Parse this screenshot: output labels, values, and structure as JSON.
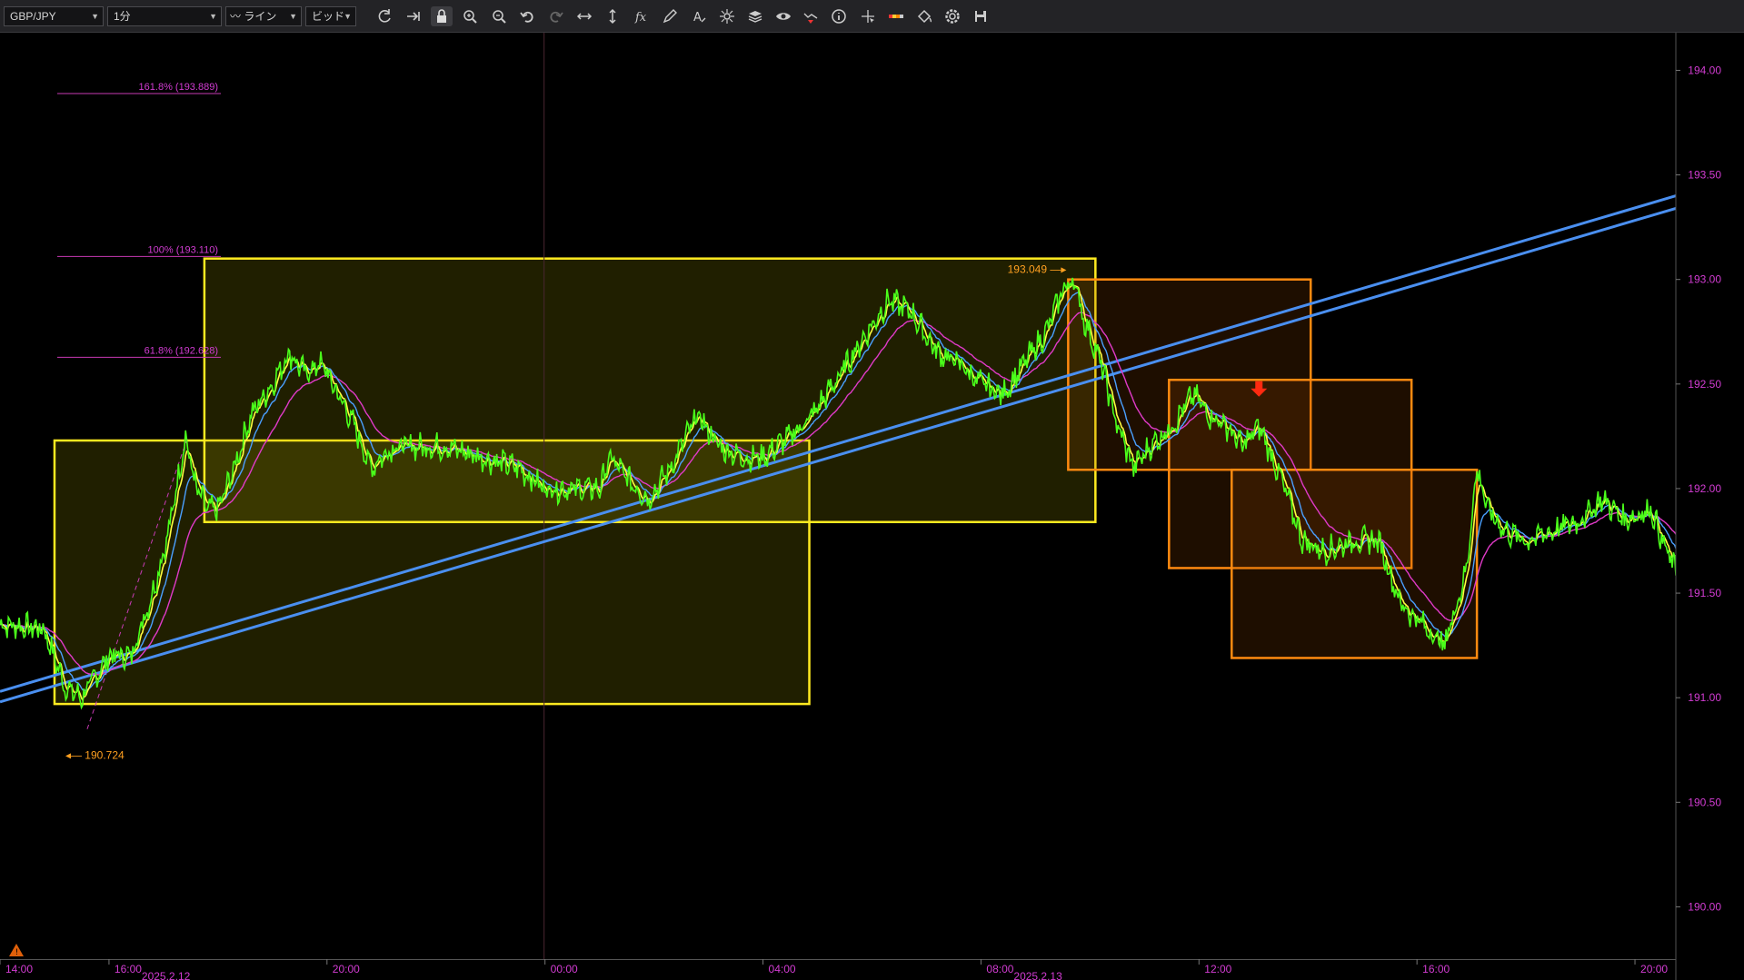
{
  "toolbar": {
    "symbol": "GBP/JPY",
    "timeframe": "1分",
    "chart_type": "ライン",
    "price_type": "ビッド",
    "icons": [
      "refresh-icon",
      "scroll-right-icon",
      "lock-icon",
      "zoom-in-icon",
      "zoom-out-icon",
      "undo-icon",
      "redo-icon",
      "fit-horizontal-icon",
      "fit-vertical-icon",
      "indicator-fx-icon",
      "pencil-icon",
      "text-icon",
      "crosshair-settings-icon",
      "layers-icon",
      "eye-icon",
      "alert-icon",
      "info-icon",
      "cursor-cross-icon",
      "color-bar-icon",
      "paint-bucket-icon",
      "settings-gear-icon",
      "save-icon"
    ]
  },
  "chart_data": {
    "type": "line",
    "symbol": "GBP/JPY",
    "y_ticks": [
      "194.00",
      "193.50",
      "193.00",
      "192.50",
      "192.00",
      "191.50",
      "191.00",
      "190.50",
      "190.00"
    ],
    "y_tick_values": [
      194.0,
      193.5,
      193.0,
      192.5,
      192.0,
      191.5,
      191.0,
      190.5,
      190.0
    ],
    "ylim": [
      189.75,
      194.18
    ],
    "x_ticks": [
      "14:00",
      "16:00",
      "20:00",
      "00:00",
      "04:00",
      "08:00",
      "12:00",
      "16:00",
      "20:00"
    ],
    "x_tick_hours": [
      0,
      2,
      6,
      10,
      14,
      18,
      22,
      26,
      30
    ],
    "date_labels": [
      {
        "text": "2025.2.12",
        "hour": 2.6
      },
      {
        "text": "2025.2.13",
        "hour": 18.6
      }
    ],
    "xlim_hours": [
      0,
      30.75
    ],
    "fibonacci": [
      {
        "label": "161.8% (193.889)",
        "value": 193.889
      },
      {
        "label": "100% (193.110)",
        "value": 193.11
      },
      {
        "label": "61.8% (192.628)",
        "value": 192.628
      }
    ],
    "annotations": {
      "high": {
        "text": "193.049",
        "value": 193.049,
        "hour": 19.6
      },
      "low": {
        "text": "190.724",
        "value": 190.724,
        "hour": 1.6
      }
    },
    "price_series_points": [
      [
        0,
        191.35
      ],
      [
        0.8,
        191.33
      ],
      [
        1.2,
        191.05
      ],
      [
        1.5,
        191.0
      ],
      [
        2.0,
        191.2
      ],
      [
        2.4,
        191.2
      ],
      [
        2.8,
        191.5
      ],
      [
        3.1,
        191.8
      ],
      [
        3.3,
        192.1
      ],
      [
        3.4,
        192.25
      ],
      [
        3.6,
        192.0
      ],
      [
        3.8,
        191.9
      ],
      [
        4.0,
        191.9
      ],
      [
        4.3,
        192.1
      ],
      [
        4.6,
        192.35
      ],
      [
        5.0,
        192.5
      ],
      [
        5.3,
        192.65
      ],
      [
        5.6,
        192.55
      ],
      [
        5.9,
        192.6
      ],
      [
        6.2,
        192.45
      ],
      [
        6.5,
        192.3
      ],
      [
        6.8,
        192.1
      ],
      [
        7.2,
        192.2
      ],
      [
        7.6,
        192.2
      ],
      [
        8.2,
        192.2
      ],
      [
        8.8,
        192.15
      ],
      [
        9.5,
        192.1
      ],
      [
        10.0,
        192.0
      ],
      [
        10.5,
        192.0
      ],
      [
        11.0,
        192.0
      ],
      [
        11.2,
        192.15
      ],
      [
        11.5,
        192.05
      ],
      [
        11.9,
        191.95
      ],
      [
        12.3,
        192.1
      ],
      [
        12.8,
        192.35
      ],
      [
        13.2,
        192.2
      ],
      [
        13.6,
        192.15
      ],
      [
        14.0,
        192.15
      ],
      [
        14.5,
        192.25
      ],
      [
        14.9,
        192.35
      ],
      [
        15.3,
        192.5
      ],
      [
        15.8,
        192.7
      ],
      [
        16.3,
        192.9
      ],
      [
        16.7,
        192.85
      ],
      [
        17.2,
        192.65
      ],
      [
        17.6,
        192.6
      ],
      [
        18.0,
        192.5
      ],
      [
        18.4,
        192.45
      ],
      [
        18.8,
        192.6
      ],
      [
        19.2,
        192.75
      ],
      [
        19.5,
        192.95
      ],
      [
        19.7,
        193.0
      ],
      [
        19.9,
        192.8
      ],
      [
        20.2,
        192.6
      ],
      [
        20.5,
        192.3
      ],
      [
        20.8,
        192.1
      ],
      [
        21.1,
        192.2
      ],
      [
        21.5,
        192.3
      ],
      [
        21.9,
        192.45
      ],
      [
        22.2,
        192.35
      ],
      [
        22.5,
        192.3
      ],
      [
        22.8,
        192.2
      ],
      [
        23.1,
        192.3
      ],
      [
        23.5,
        192.05
      ],
      [
        23.9,
        191.75
      ],
      [
        24.3,
        191.7
      ],
      [
        24.8,
        191.75
      ],
      [
        25.3,
        191.75
      ],
      [
        25.7,
        191.45
      ],
      [
        26.1,
        191.35
      ],
      [
        26.5,
        191.25
      ],
      [
        26.9,
        191.6
      ],
      [
        27.1,
        192.1
      ],
      [
        27.3,
        191.9
      ],
      [
        27.6,
        191.8
      ],
      [
        28.0,
        191.75
      ],
      [
        28.5,
        191.8
      ],
      [
        29.0,
        191.85
      ],
      [
        29.4,
        191.95
      ],
      [
        29.8,
        191.85
      ],
      [
        30.3,
        191.9
      ],
      [
        30.5,
        191.75
      ],
      [
        30.75,
        191.6
      ]
    ],
    "rectangles": [
      {
        "color": "#ffea20",
        "fill": "rgba(180,170,0,0.18)",
        "x": [
          1.0,
          14.85
        ],
        "y": [
          190.97,
          192.23
        ]
      },
      {
        "color": "#ffea20",
        "fill": "rgba(180,170,0,0.18)",
        "x": [
          3.75,
          20.1
        ],
        "y": [
          191.84,
          193.1
        ]
      },
      {
        "color": "#ff8a10",
        "fill": "rgba(150,70,0,0.20)",
        "x": [
          19.6,
          24.05
        ],
        "y": [
          192.09,
          193.0
        ]
      },
      {
        "color": "#ff8a10",
        "fill": "rgba(150,70,0,0.20)",
        "x": [
          21.45,
          25.9
        ],
        "y": [
          191.62,
          192.52
        ]
      },
      {
        "color": "#ff8a10",
        "fill": "rgba(150,70,0,0.20)",
        "x": [
          22.6,
          27.1
        ],
        "y": [
          191.19,
          192.09
        ]
      }
    ],
    "trendlines": [
      {
        "color": "#4a8ff0",
        "x": [
          0,
          30.75
        ],
        "y": [
          191.03,
          193.4
        ]
      },
      {
        "color": "#4a8ff0",
        "x": [
          0,
          30.75
        ],
        "y": [
          190.98,
          193.34
        ]
      }
    ],
    "signal": {
      "type": "sell-arrow",
      "color": "#ff2a10",
      "hour": 23.1,
      "value": 192.47
    },
    "series": [
      {
        "color": "#4aff1a"
      },
      {
        "color": "#ffff40"
      },
      {
        "color": "#4aa0ff"
      },
      {
        "color": "#e03ac8"
      }
    ]
  }
}
